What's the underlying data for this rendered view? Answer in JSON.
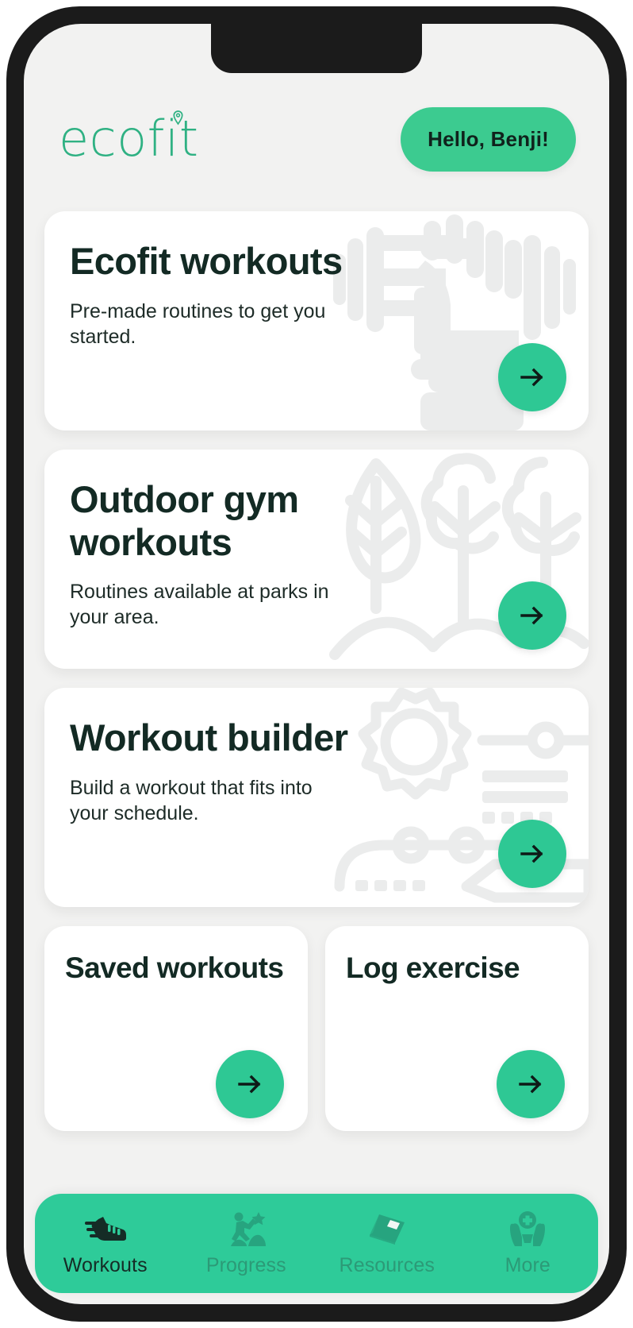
{
  "app": {
    "logo_text": "ecofit",
    "brand_green": "#2fb183",
    "accent_green": "#2ec894",
    "nav_green": "#2ecb99",
    "screen_bg": "#f2f2f1",
    "dark_text": "#132a24"
  },
  "header": {
    "greeting_label": "Hello, Benji!"
  },
  "cards": [
    {
      "title": "Ecofit workouts",
      "subtitle": "Pre-made routines to get you started.",
      "art": "dumbbell-hand-icon",
      "action_label": "→"
    },
    {
      "title": "Outdoor gym workouts",
      "subtitle": "Routines available at parks in your area.",
      "art": "trees-icon",
      "action_label": "→"
    },
    {
      "title": "Workout builder",
      "subtitle": "Build a workout that fits into your schedule.",
      "art": "gear-flowchart-icon",
      "action_label": "→"
    }
  ],
  "small_cards": [
    {
      "title": "Saved workouts",
      "action_label": "→"
    },
    {
      "title": "Log exercise",
      "action_label": "→"
    }
  ],
  "bottom_nav": {
    "items": [
      {
        "label": "Workouts",
        "icon": "running-shoe-icon",
        "active": true
      },
      {
        "label": "Progress",
        "icon": "climbing-star-icon",
        "active": false
      },
      {
        "label": "Resources",
        "icon": "book-icon",
        "active": false
      },
      {
        "label": "More",
        "icon": "hands-plus-icon",
        "active": false
      }
    ]
  }
}
